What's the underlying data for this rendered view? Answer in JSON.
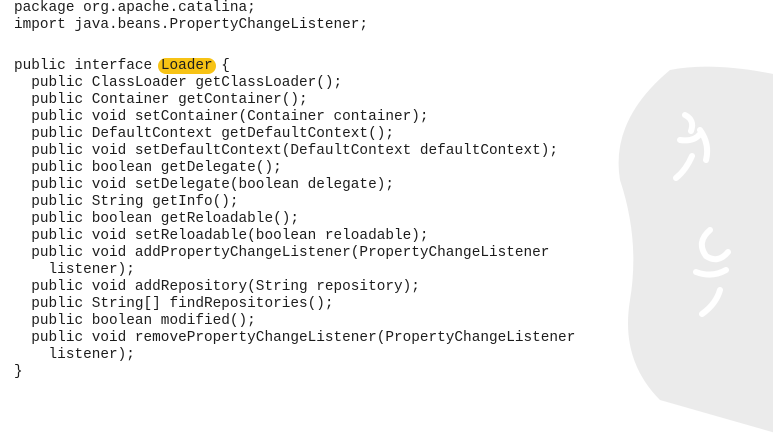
{
  "code": {
    "lines": [
      "package org.apache.catalina;",
      "import java.beans.PropertyChangeListener;",
      "",
      "public interface ",
      "  public ClassLoader getClassLoader();",
      "  public Container getContainer();",
      "  public void setContainer(Container container);",
      "  public DefaultContext getDefaultContext();",
      "  public void setDefaultContext(DefaultContext defaultContext);",
      "  public boolean getDelegate();",
      "  public void setDelegate(boolean delegate);",
      "  public String getInfo();",
      "  public boolean getReloadable();",
      "  public void setReloadable(boolean reloadable);",
      "  public void addPropertyChangeListener(PropertyChangeListener",
      "    listener);",
      "  public void addRepository(String repository);",
      "  public String[] findRepositories();",
      "  public boolean modified();",
      "  public void removePropertyChangeListener(PropertyChangeListener",
      "    listener);",
      "}"
    ],
    "highlighted_word": "Loader",
    "highlight_color": "#f7c315",
    "after_highlight": " {"
  }
}
